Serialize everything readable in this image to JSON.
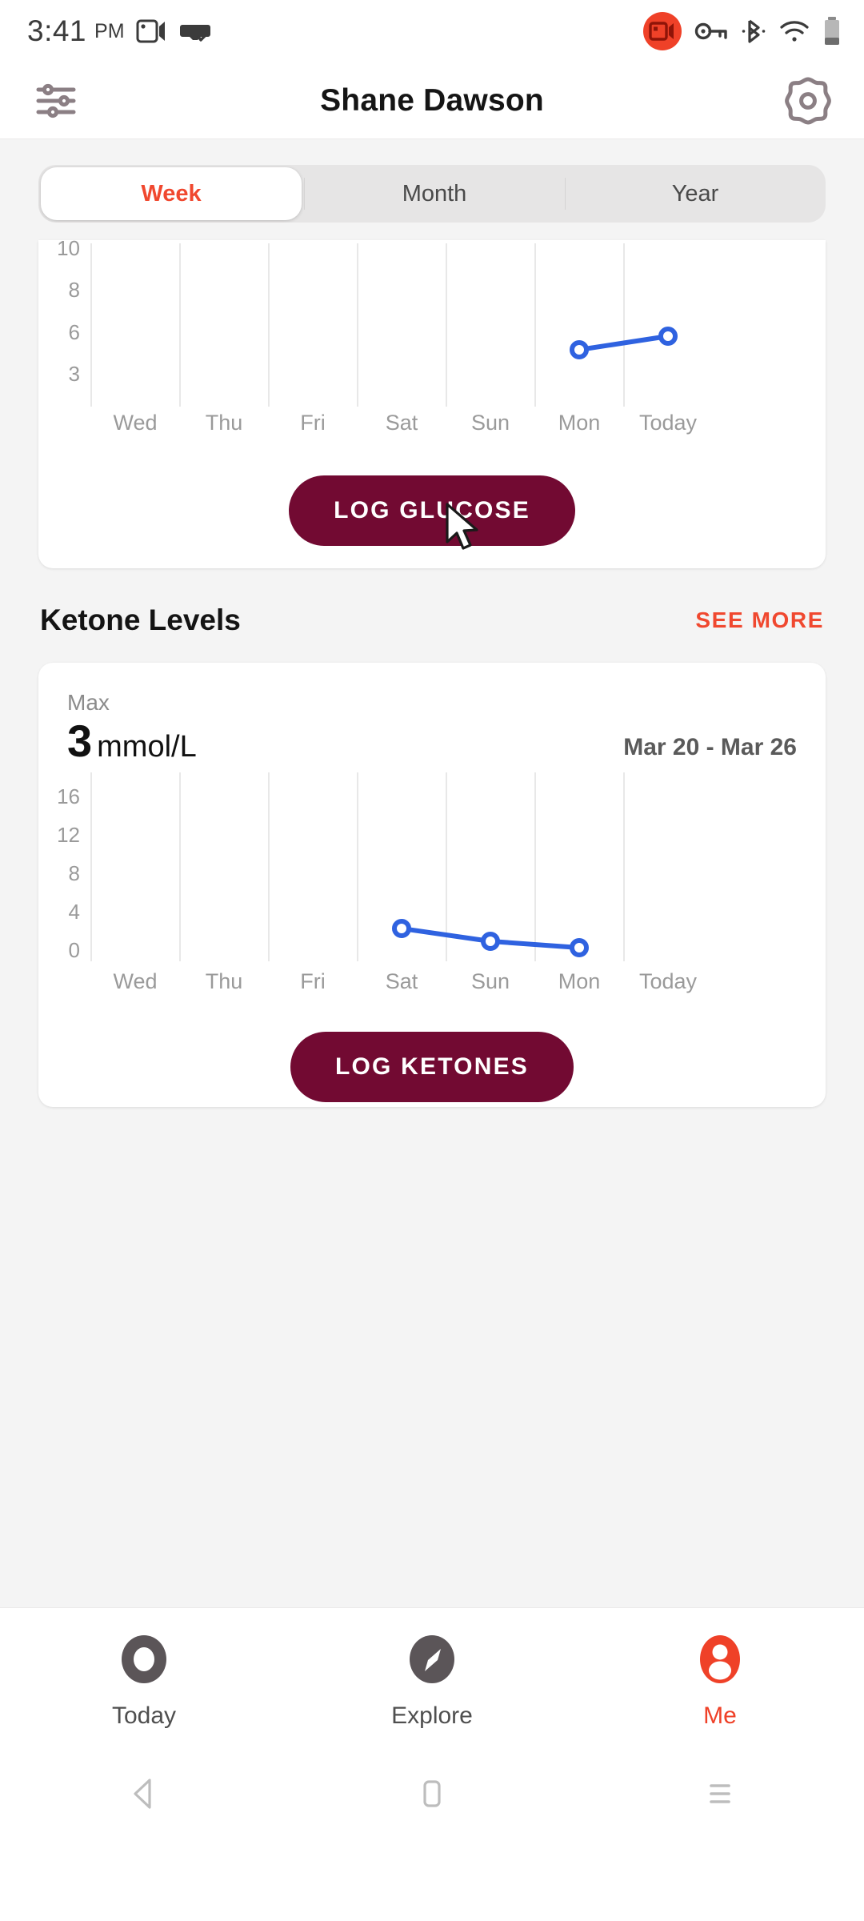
{
  "status_bar": {
    "time": "3:41",
    "ampm": "PM",
    "icons": [
      "screen-record-icon",
      "vr-headset-icon",
      "screen-cast-recording-icon",
      "key-icon",
      "bluetooth-icon",
      "wifi-icon",
      "battery-icon"
    ]
  },
  "header": {
    "title": "Shane Dawson",
    "left_icon": "sliders-icon",
    "right_icon": "gear-icon"
  },
  "range_tabs": {
    "selected": "Week",
    "options": [
      "Week",
      "Month",
      "Year"
    ]
  },
  "glucose_card": {
    "log_button": "LOG GLUCOSE"
  },
  "ketone_section": {
    "title": "Ketone Levels",
    "see_more": "SEE MORE",
    "max_label": "Max",
    "max_value": "3",
    "max_unit": "mmol/L",
    "date_range": "Mar 20 - Mar 26",
    "log_button": "LOG KETONES"
  },
  "bottom_nav": {
    "items": [
      {
        "label": "Today",
        "icon": "circle-today-icon",
        "active": false
      },
      {
        "label": "Explore",
        "icon": "compass-icon",
        "active": false
      },
      {
        "label": "Me",
        "icon": "person-icon",
        "active": true
      }
    ]
  },
  "system_nav": {
    "back": "back-triangle-icon",
    "home": "home-square-icon",
    "recents": "recents-lines-icon"
  },
  "colors": {
    "accent_red": "#ef4128",
    "button_maroon": "#720a32",
    "line_blue": "#2f62e0",
    "axis_gray": "#9a9a9a",
    "page_bg": "#f4f4f4"
  },
  "chart_data": [
    {
      "type": "line",
      "title": "Glucose Levels",
      "categories": [
        "Wed",
        "Thu",
        "Fri",
        "Sat",
        "Sun",
        "Mon",
        "Today"
      ],
      "values": [
        null,
        null,
        null,
        null,
        null,
        5.5,
        6.2
      ],
      "ytick_labels": [
        "10",
        "8",
        "6",
        "3"
      ],
      "yticks": [
        10,
        8,
        6,
        3
      ],
      "ylim": [
        2,
        11
      ],
      "xlabel": "",
      "ylabel": "",
      "grid": true,
      "series_color": "#2f62e0",
      "marker": "open-circle"
    },
    {
      "type": "line",
      "title": "Ketone Levels",
      "categories": [
        "Wed",
        "Thu",
        "Fri",
        "Sat",
        "Sun",
        "Mon",
        "Today"
      ],
      "values": [
        null,
        null,
        null,
        3.0,
        1.7,
        1.0,
        null
      ],
      "ytick_labels": [
        "16",
        "12",
        "8",
        "4",
        "0"
      ],
      "yticks": [
        16,
        12,
        8,
        4,
        0
      ],
      "ylim": [
        0,
        18
      ],
      "xlabel": "",
      "ylabel": "mmol/L",
      "grid": true,
      "series_color": "#2f62e0",
      "marker": "open-circle",
      "max": 3,
      "unit": "mmol/L",
      "date_range": "Mar 20 - Mar 26"
    }
  ]
}
